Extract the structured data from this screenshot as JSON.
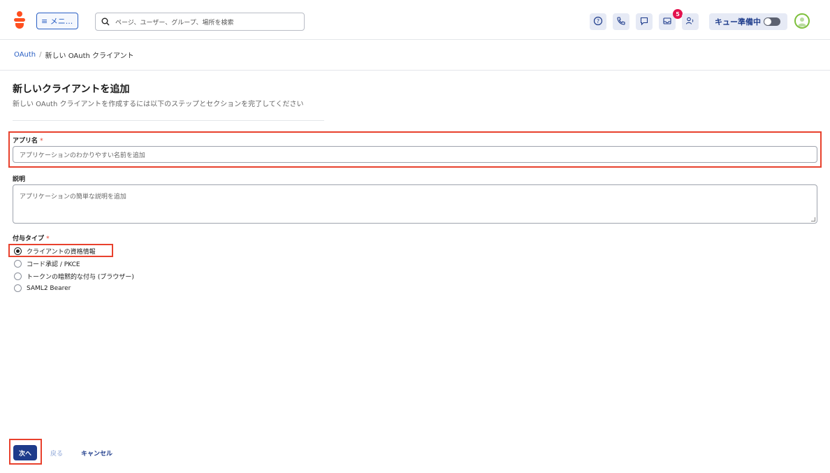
{
  "header": {
    "menu_label": "≡ メニ...",
    "search_placeholder": "ページ、ユーザー、グループ、場所を検索",
    "notification_count": "5",
    "queue_label": "キュー準備中"
  },
  "breadcrumb": {
    "parent": "OAuth",
    "separator": "/",
    "current": "新しい OAuth クライアント"
  },
  "page": {
    "title": "新しいクライアントを追加",
    "subtitle": "新しい OAuth クライアントを作成するには以下のステップとセクションを完了してください"
  },
  "form": {
    "app_name_label": "アプリ名",
    "required_mark": "*",
    "app_name_placeholder": "アプリケーションのわかりやすい名前を追加",
    "description_label": "説明",
    "description_placeholder": "アプリケーションの簡単な説明を追加",
    "grant_type_label": "付与タイプ",
    "grant_types": [
      {
        "label": "クライアントの資格情報",
        "checked": true
      },
      {
        "label": "コード承認 / PKCE",
        "checked": false
      },
      {
        "label": "トークンの暗黙的な付与 (ブラウザー)",
        "checked": false
      },
      {
        "label": "SAML2 Bearer",
        "checked": false
      }
    ]
  },
  "actions": {
    "next": "次へ",
    "back": "戻る",
    "cancel": "キャンセル"
  },
  "colors": {
    "brand": "#ff4f1f",
    "primary": "#1d3b8b",
    "highlight": "#e8412d"
  }
}
